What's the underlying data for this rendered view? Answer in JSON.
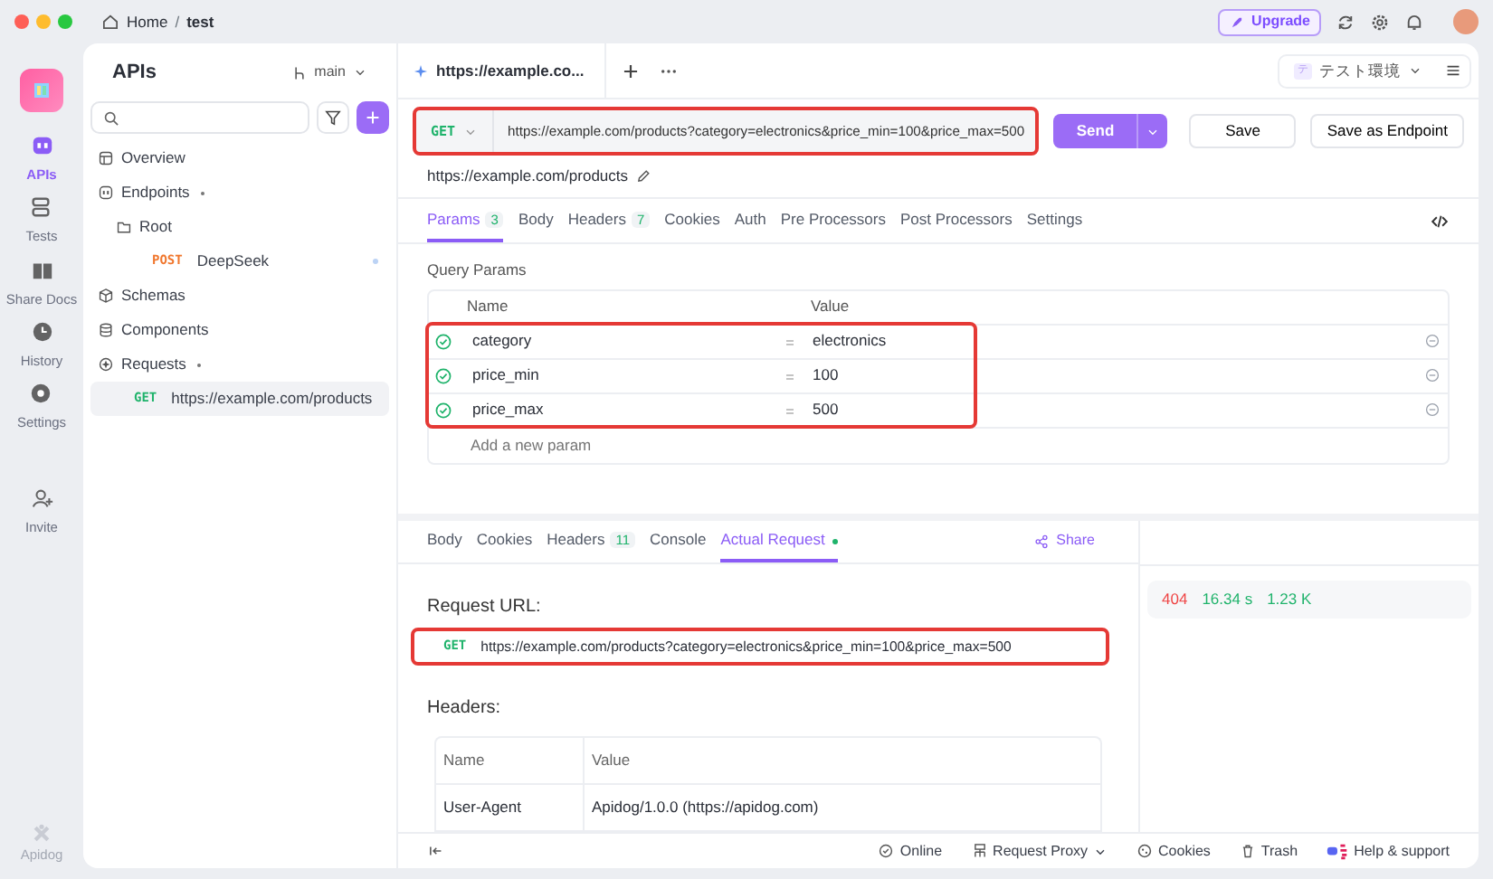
{
  "breadcrumb": {
    "items": [
      "Home",
      "test"
    ],
    "separator": "/"
  },
  "top_actions": {
    "upgrade": "Upgrade"
  },
  "rail": [
    {
      "label": "APIs",
      "selected": true
    },
    {
      "label": "Tests",
      "selected": false
    },
    {
      "label": "Share Docs",
      "selected": false
    },
    {
      "label": "History",
      "selected": false
    },
    {
      "label": "Settings",
      "selected": false
    },
    {
      "label": "Invite",
      "selected": false
    }
  ],
  "rail_brand": "Apidog",
  "sidebar": {
    "title": "APIs",
    "branch": "main",
    "tree": [
      {
        "label": "Overview",
        "kind": "section",
        "selected": false
      },
      {
        "label": "Endpoints",
        "kind": "section",
        "selected": false,
        "children": [
          {
            "label": "Root",
            "kind": "folder",
            "selected": false,
            "children": [
              {
                "label": "DeepSeek",
                "kind": "request",
                "method": "POST",
                "color": "#f0772e",
                "selected": false
              }
            ]
          }
        ]
      },
      {
        "label": "Schemas",
        "kind": "section",
        "selected": false
      },
      {
        "label": "Components",
        "kind": "section",
        "selected": false
      },
      {
        "label": "Requests",
        "kind": "section",
        "selected": false,
        "children": [
          {
            "label": "https://example.com/products",
            "kind": "request",
            "method": "GET",
            "color": "#1fb36b",
            "selected": true
          }
        ]
      }
    ]
  },
  "open_tab": "https://example.co...",
  "environment": {
    "badge": "テ",
    "name": "テスト環境"
  },
  "request": {
    "method": "GET",
    "url": "https://example.com/products?category=electronics&price_min=100&price_max=500",
    "highlighted": true,
    "buttons": [
      "Send",
      "Save",
      "Save as Endpoint"
    ],
    "path": "https://example.com/products"
  },
  "request_tabs": [
    {
      "label": "Params",
      "count": "3",
      "selected": true
    },
    {
      "label": "Body",
      "selected": false
    },
    {
      "label": "Headers",
      "count": "7",
      "selected": false
    },
    {
      "label": "Cookies",
      "selected": false
    },
    {
      "label": "Auth",
      "selected": false
    },
    {
      "label": "Pre Processors",
      "selected": false
    },
    {
      "label": "Post Processors",
      "selected": false
    },
    {
      "label": "Settings",
      "selected": false
    }
  ],
  "query_params": {
    "title": "Query Params",
    "columns": [
      "Name",
      "Value"
    ],
    "highlighted": true,
    "placeholder": "Add a new param",
    "rows": [
      {
        "name": "category",
        "value": "electronics",
        "enabled": true
      },
      {
        "name": "price_min",
        "value": "100",
        "enabled": true
      },
      {
        "name": "price_max",
        "value": "500",
        "enabled": true
      }
    ]
  },
  "response_tabs": [
    {
      "label": "Body",
      "selected": false
    },
    {
      "label": "Cookies",
      "selected": false
    },
    {
      "label": "Headers",
      "count": "11",
      "selected": false
    },
    {
      "label": "Console",
      "selected": false
    },
    {
      "label": "Actual Request",
      "selected": true,
      "dot": true
    }
  ],
  "share": "Share",
  "actual_request": {
    "url_label": "Request URL:",
    "method": "GET",
    "url": "https://example.com/products?category=electronics&price_min=100&price_max=500",
    "highlighted": true,
    "headers_label": "Headers:",
    "columns": [
      "Name",
      "Value"
    ],
    "rows": [
      {
        "name": "User-Agent",
        "value": "Apidog/1.0.0 (https://apidog.com)"
      }
    ]
  },
  "response_stats": {
    "status": "404",
    "time": "16.34 s",
    "size": "1.23 K"
  },
  "footer": [
    {
      "label": "Online"
    },
    {
      "label": "Request Proxy",
      "caret": true
    },
    {
      "label": "Cookies"
    },
    {
      "label": "Trash"
    },
    {
      "label": "Help & support"
    }
  ]
}
